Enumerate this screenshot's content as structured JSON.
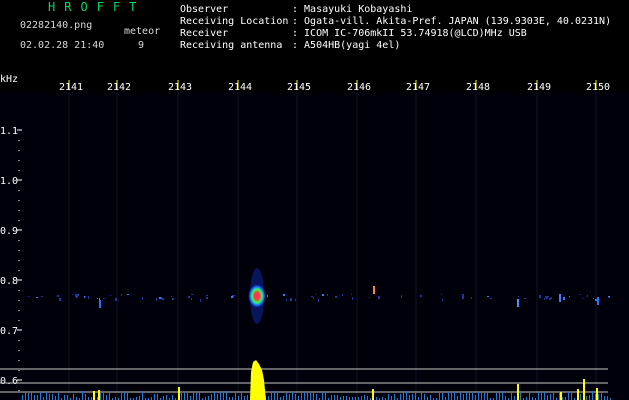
{
  "header": {
    "title": "HROFFT",
    "filename": "02282140.png",
    "timestamp": "02.02.28 21:40",
    "meteor_label": "meteor",
    "meteor_count": "9",
    "colors": {
      "title": "#00d860",
      "text": "#ffffff",
      "accent_yellow": "#ffff00"
    }
  },
  "info": [
    {
      "label": "Observer",
      "value": ": Masayuki Kobayashi"
    },
    {
      "label": "Receiving Location",
      "value": ": Ogata-vill. Akita-Pref. JAPAN (139.9303E, 40.0231N)"
    },
    {
      "label": "Receiver",
      "value": ": ICOM IC-706mkII 53.74918(@LCD)MHz USB"
    },
    {
      "label": "Receiving antenna",
      "value": ": A504HB(yagi 4el)"
    }
  ],
  "axis": {
    "y_unit": "kHz",
    "y_ticks": [
      "1.1",
      "1.0",
      "0.9",
      "0.8",
      "0.7",
      "0.6"
    ],
    "x_ticks": [
      "2141",
      "2142",
      "2143",
      "2144",
      "2145",
      "2146",
      "2147",
      "2148",
      "2149",
      "2150"
    ]
  },
  "plot": {
    "echo_time_tick": 2144,
    "echo_khz": 0.765,
    "baseline_khz": 0.762
  }
}
